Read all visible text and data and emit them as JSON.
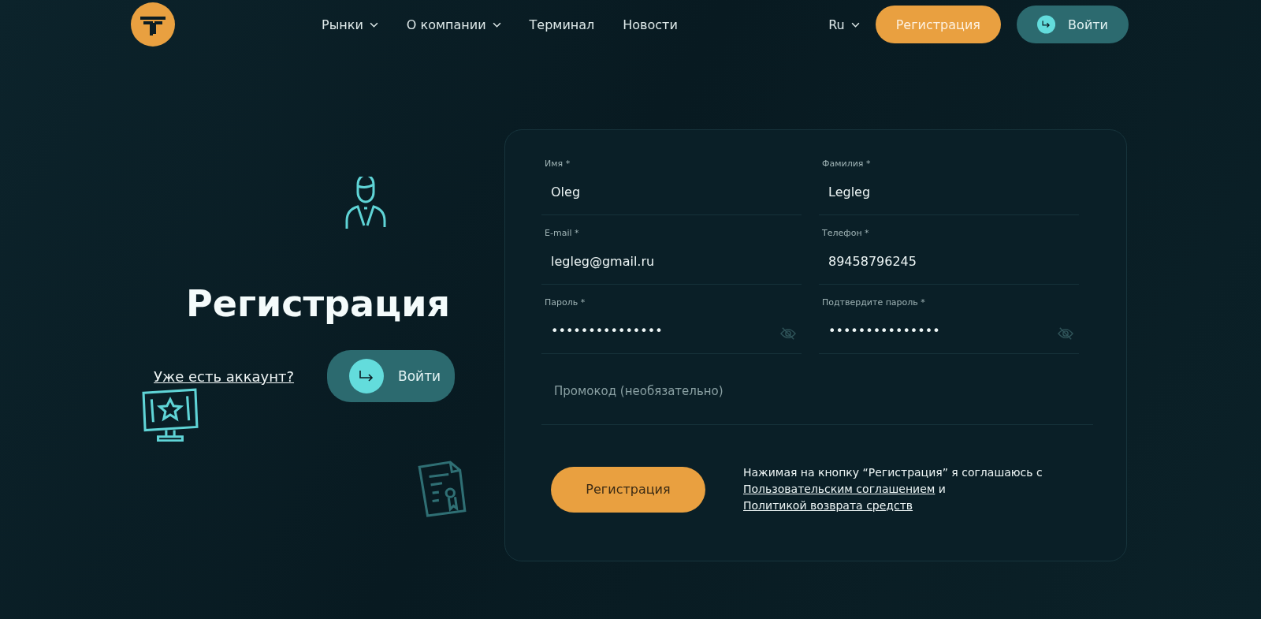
{
  "header": {
    "nav": [
      {
        "label": "Рынки",
        "dropdown": true
      },
      {
        "label": "О компании",
        "dropdown": true
      },
      {
        "label": "Терминал",
        "dropdown": false
      },
      {
        "label": "Новости",
        "dropdown": false
      }
    ],
    "language": "Ru",
    "register_button": "Регистрация",
    "login_button": "Войти"
  },
  "intro": {
    "title": "Регистрация",
    "account_link": "Уже есть аккаунт?",
    "login_button": "Войти"
  },
  "form": {
    "fields": [
      {
        "label": "Имя *",
        "value": "Oleg",
        "kind": "text"
      },
      {
        "label": "Фамилия *",
        "value": "Legleg",
        "kind": "text"
      },
      {
        "label": "E-mail *",
        "value": "legleg@gmail.ru",
        "kind": "text"
      },
      {
        "label": "Телефон *",
        "value": "89458796245",
        "kind": "text"
      },
      {
        "label": "Пароль *",
        "value": "•••••••••••••••",
        "kind": "password"
      },
      {
        "label": "Подтвердите пароль *",
        "value": "•••••••••••••••",
        "kind": "password"
      }
    ],
    "promo": {
      "placeholder": "Промокод (необязательно)"
    },
    "submit": "Регистрация",
    "agreement": {
      "before": "Нажимая на кнопку “Регистрация” я соглашаюсь с",
      "link_1": "Пользовательским соглашением",
      "middle": "и",
      "link_2": "Политикой возврата средств"
    }
  }
}
